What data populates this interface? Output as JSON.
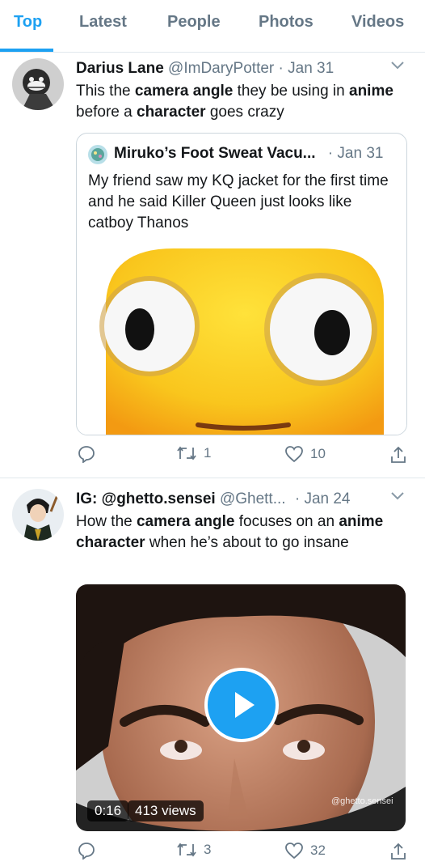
{
  "tabs": [
    {
      "label": "Top",
      "active": true
    },
    {
      "label": "Latest",
      "active": false
    },
    {
      "label": "People",
      "active": false
    },
    {
      "label": "Photos",
      "active": false
    },
    {
      "label": "Videos",
      "active": false
    }
  ],
  "tweets": [
    {
      "name": "Darius Lane",
      "handle": "@ImDaryPotter",
      "sep": "·",
      "date": "Jan 31",
      "text": [
        {
          "t": "This the ",
          "b": false
        },
        {
          "t": "camera angle",
          "b": true
        },
        {
          "t": " they be using in ",
          "b": false
        },
        {
          "t": "anime",
          "b": true
        },
        {
          "t": " before a ",
          "b": false
        },
        {
          "t": "character",
          "b": true
        },
        {
          "t": " goes crazy",
          "b": false
        }
      ],
      "quote": {
        "name": "Miruko’s Foot Sweat Vacu...",
        "sep": "·",
        "date": "Jan 31",
        "text": "My friend saw my KQ jacket for the first time and he said Killer Queen just looks like catboy Thanos"
      },
      "actions": {
        "reply": "",
        "retweet": "1",
        "like": "10"
      }
    },
    {
      "name": "IG: @ghetto.sensei",
      "handle": "@Ghett...",
      "sep": "·",
      "date": "Jan 24",
      "text": [
        {
          "t": "How the ",
          "b": false
        },
        {
          "t": "camera angle",
          "b": true
        },
        {
          "t": " focuses on an ",
          "b": false
        },
        {
          "t": "anime character",
          "b": true
        },
        {
          "t": " when he’s about to go insane",
          "b": false
        }
      ],
      "video": {
        "time": "0:16",
        "views": "413 views",
        "watermark": "@ghetto.sensei"
      },
      "actions": {
        "reply": "",
        "retweet": "3",
        "like": "32"
      }
    }
  ],
  "icons": [
    "reply-icon",
    "retweet-icon",
    "like-icon",
    "share-icon",
    "chevron-down-icon",
    "play-icon"
  ],
  "colors": {
    "accent": "#1da1f2",
    "secondary_text": "#657786",
    "border": "#e1e8ed"
  }
}
